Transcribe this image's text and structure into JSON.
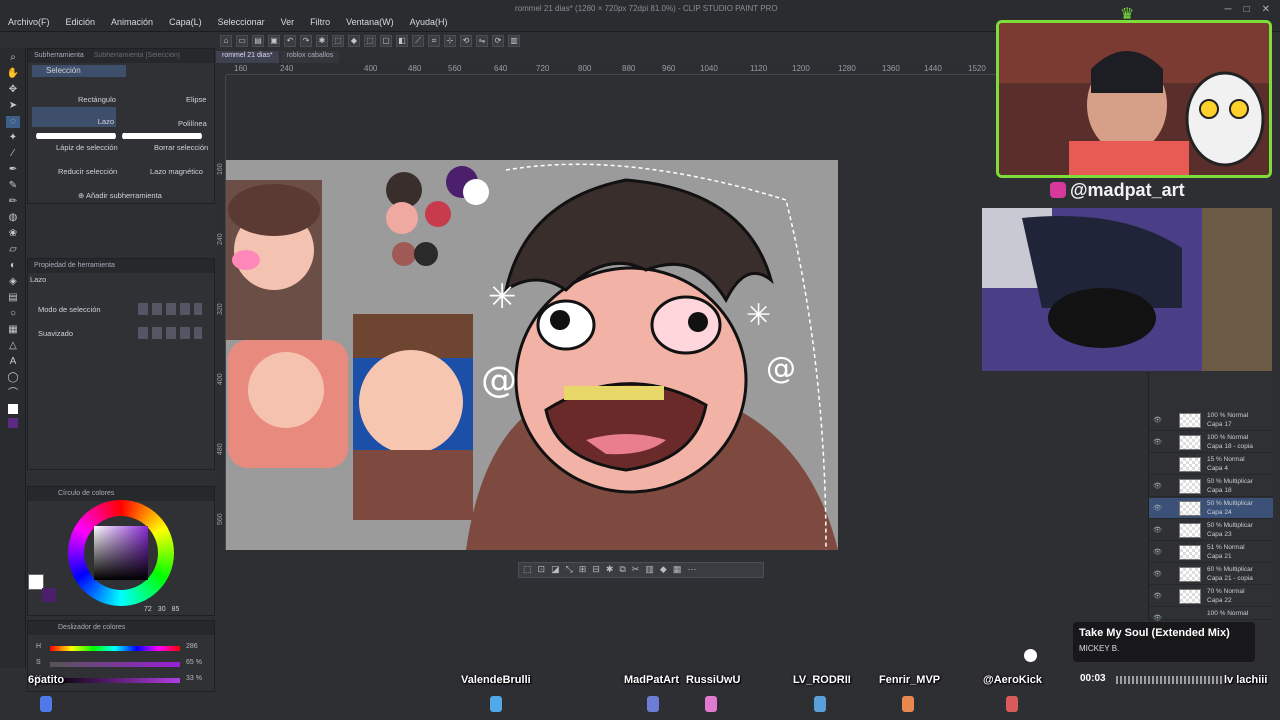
{
  "window": {
    "title": "rommel 21 dias* (1280 × 720px 72dpi 81.0%) - CLIP STUDIO PAINT PRO",
    "menu": [
      "Archivo(F)",
      "Edición",
      "Animación",
      "Capa(L)",
      "Seleccionar",
      "Ver",
      "Filtro",
      "Ventana(W)",
      "Ayuda(H)"
    ]
  },
  "doc_tabs": [
    "rommel 21 dias*",
    "roblox caballos"
  ],
  "ruler_top": [
    "160",
    "240",
    "400",
    "480",
    "560",
    "640",
    "720",
    "800",
    "880",
    "960",
    "1040",
    "1120",
    "1200",
    "1280",
    "1360",
    "1440",
    "1520"
  ],
  "ruler_left": [
    "160",
    "240",
    "320",
    "400",
    "480",
    "560"
  ],
  "subtool_panel": {
    "tab1": "Subherramienta",
    "tab2": "Subherramienta [Selección]",
    "group": "Selección",
    "tools": [
      "Rectángulo",
      "Elipse",
      "Lazo",
      "Polilínea",
      "Lápiz de selección",
      "Borrar selección",
      "Reducir selección",
      "Lazo magnético"
    ],
    "add": "Añadir subherramienta"
  },
  "props_panel": {
    "header": "Propiedad de herramienta",
    "tool": "Lazo",
    "mode_label": "Modo de selección",
    "smooth_label": "Suavizado"
  },
  "color_panel": {
    "header": "Círculo de colores",
    "values": [
      "72",
      "30",
      "85"
    ]
  },
  "slider_panel": {
    "header": "Deslizador de colores",
    "h_label": "H",
    "h_value": "286",
    "s_label": "S",
    "s_value": "65 %",
    "v_label": "V",
    "v_value": "33 %"
  },
  "stream": {
    "instagram": "@madpat_art",
    "song_title": "Take My Soul (Extended Mix)",
    "song_artist": "MICKEY B.",
    "elapsed": "00:03",
    "corner_label": "lv lachiii",
    "viewers": [
      "6patito",
      "ValendeBrulli",
      "MadPatArt",
      "RussiUwU",
      "LV_RODRII",
      "Fenrir_MVP",
      "@AeroKick"
    ]
  },
  "layers": [
    {
      "blend": "100 % Normal",
      "name": "Capa 17"
    },
    {
      "blend": "100 % Normal",
      "name": "Capa 18 - copia"
    },
    {
      "blend": "15 % Normal",
      "name": "Capa 4"
    },
    {
      "blend": "50 % Multiplicar",
      "name": "Capa 18"
    },
    {
      "blend": "50 % Multiplicar",
      "name": "Capa 24",
      "selected": true
    },
    {
      "blend": "50 % Multiplicar",
      "name": "Capa 23"
    },
    {
      "blend": "51 % Normal",
      "name": "Capa 21"
    },
    {
      "blend": "60 % Multiplicar",
      "name": "Capa 21 - copia"
    },
    {
      "blend": "70 % Normal",
      "name": "Capa 22"
    },
    {
      "blend": "100 % Normal",
      "name": ""
    }
  ],
  "colors": {
    "accent": "#3b5177",
    "webcam_border": "#7dde3a",
    "palette": [
      "#3a2e2c",
      "#4b1f6b",
      "#ffffff",
      "#f0a9a0",
      "#c73b4d",
      "#a05a55",
      "#2a2a2a"
    ]
  }
}
